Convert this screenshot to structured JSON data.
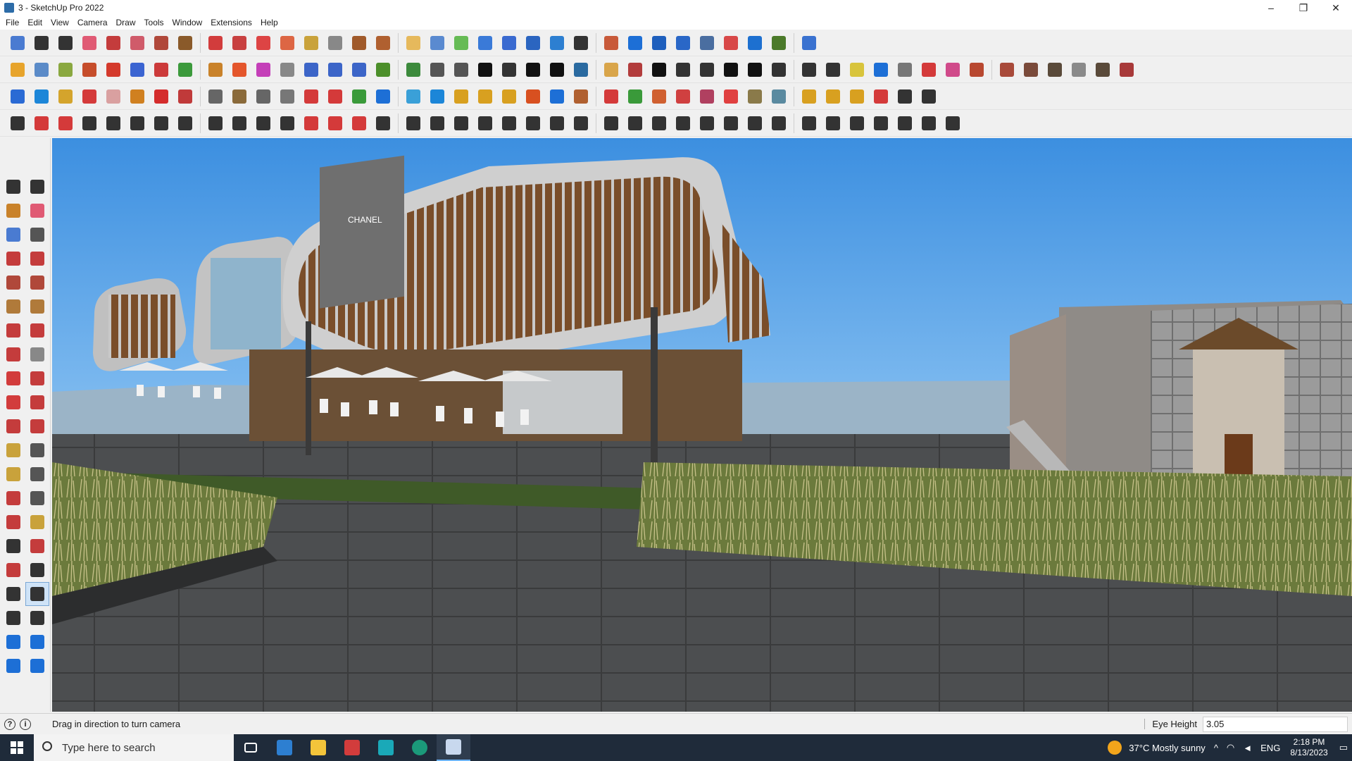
{
  "window": {
    "title": "3 - SketchUp Pro 2022",
    "minimize": "–",
    "restore": "❐",
    "close": "✕"
  },
  "menu": [
    "File",
    "Edit",
    "View",
    "Camera",
    "Draw",
    "Tools",
    "Window",
    "Extensions",
    "Help"
  ],
  "toolbars": {
    "row1": [
      "#4a7bd1",
      "#333",
      "#333",
      "#e05a74",
      "#c43c3c",
      "#d05b6a",
      "#b0483a",
      "#8a5a2a",
      "#d23c3c",
      "#c84040",
      "#d44",
      "#d64",
      "#c9a23b",
      "#888",
      "#a05a2a",
      "#b06030",
      "#e6b95c",
      "#5a8ad0",
      "#6b5",
      "#3a7ad8",
      "#3a6ad0",
      "#2b65c0",
      "#2d7fd1",
      "#333",
      "#c85a3a",
      "#1d6fd6",
      "#1e5fbd",
      "#2a67c7",
      "#4a6ea0",
      "#d84848",
      "#1d70d0",
      "#4b7a2a",
      "#3a72d0"
    ],
    "row2": [
      "#e7a42c",
      "#5b8bc8",
      "#8aa840",
      "#c64d2b",
      "#d43a2c",
      "#3b64d1",
      "#cc3a3a",
      "#3c9a3c",
      "#c9822a",
      "#e4562c",
      "#c43fb8",
      "#888",
      "#3c65c8",
      "#3c65c8",
      "#3c65c8",
      "#4c8f2a",
      "#3c8a3c",
      "#555",
      "#555",
      "#111",
      "#333",
      "#111",
      "#111",
      "#2a6aa0",
      "#d9a54a",
      "#b23c3c",
      "#111",
      "#333",
      "#333",
      "#111",
      "#111",
      "#333",
      "#333",
      "#333",
      "#d8c43c",
      "#1d6fd6",
      "#777",
      "#d43a3a",
      "#d04a8a",
      "#b84830",
      "#a84a3a",
      "#7a4a3a",
      "#5a4a3a",
      "#8a8a8a",
      "#5a4a3a",
      "#a83a3a"
    ],
    "row3": [
      "#2a6ad4",
      "#1c86d8",
      "#d4a42c",
      "#d43a3a",
      "#d9a0a0",
      "#d08020",
      "#d42c2c",
      "#c03a3a",
      "#666",
      "#8a6a3a",
      "#666",
      "#777",
      "#d43a3a",
      "#d43a3a",
      "#3a9a3a",
      "#1d6fd6",
      "#3aa0d8",
      "#1c86d8",
      "#d8a020",
      "#d8a020",
      "#d8a020",
      "#d85020",
      "#1d6fd6",
      "#b06030",
      "#d43a3a",
      "#3a9a3a",
      "#d06030",
      "#d04040",
      "#b04060",
      "#e04040",
      "#8a7a4a",
      "#5a8aa0",
      "#d8a020",
      "#d8a020",
      "#d8a020",
      "#d43a3a",
      "#333",
      "#333"
    ],
    "row4": [
      "#333",
      "#d43a3a",
      "#d43a3a",
      "#333",
      "#333",
      "#333",
      "#333",
      "#333",
      "#333",
      "#333",
      "#333",
      "#333",
      "#d43a3a",
      "#d43a3a",
      "#d43a3a",
      "#333",
      "#333",
      "#333",
      "#333",
      "#333",
      "#333",
      "#333",
      "#333",
      "#333",
      "#333",
      "#333",
      "#333",
      "#333",
      "#333",
      "#333",
      "#333",
      "#333",
      "#333",
      "#333",
      "#333",
      "#333",
      "#333",
      "#333",
      "#333"
    ]
  },
  "left_tools": [
    {
      "name": "select-tool",
      "c": "#333"
    },
    {
      "name": "orbit-tool",
      "c": "#333"
    },
    {
      "name": "paint-bucket-tool",
      "c": "#c9822a"
    },
    {
      "name": "eraser-tool",
      "c": "#e05a74"
    },
    {
      "name": "component-tool",
      "c": "#4a7bd1"
    },
    {
      "name": "tape-tool",
      "c": "#555"
    },
    {
      "name": "line-tool",
      "c": "#c43c3c"
    },
    {
      "name": "freehand-tool",
      "c": "#c43c3c"
    },
    {
      "name": "rectangle-tool",
      "c": "#b0483a"
    },
    {
      "name": "rotated-rectangle-tool",
      "c": "#b0483a"
    },
    {
      "name": "circle-tool",
      "c": "#b07a3a"
    },
    {
      "name": "polygon-tool",
      "c": "#b07a3a"
    },
    {
      "name": "arc-tool",
      "c": "#c43c3c"
    },
    {
      "name": "two-point-arc-tool",
      "c": "#c43c3c"
    },
    {
      "name": "pie-tool",
      "c": "#c43c3c"
    },
    {
      "name": "push-pull-small-tool",
      "c": "#888"
    },
    {
      "name": "move-tool",
      "c": "#d23c3c"
    },
    {
      "name": "push-pull-tool",
      "c": "#c43c3c"
    },
    {
      "name": "rotate-tool",
      "c": "#d23c3c"
    },
    {
      "name": "follow-me-tool",
      "c": "#c43c3c"
    },
    {
      "name": "scale-tool",
      "c": "#c43c3c"
    },
    {
      "name": "offset-tool",
      "c": "#c43c3c"
    },
    {
      "name": "tape-measure-tool",
      "c": "#c9a23b"
    },
    {
      "name": "dimension-tool",
      "c": "#555"
    },
    {
      "name": "protractor-tool",
      "c": "#c9a23b"
    },
    {
      "name": "text-tool",
      "c": "#555"
    },
    {
      "name": "axes-tool",
      "c": "#c43c3c"
    },
    {
      "name": "3d-text-tool",
      "c": "#555"
    },
    {
      "name": "orbit-camera-tool",
      "c": "#c43c3c"
    },
    {
      "name": "pan-tool",
      "c": "#c9a23b"
    },
    {
      "name": "zoom-tool",
      "c": "#333"
    },
    {
      "name": "zoom-window-tool",
      "c": "#c43c3c"
    },
    {
      "name": "zoom-extents-tool",
      "c": "#c43c3c"
    },
    {
      "name": "previous-view-tool",
      "c": "#333"
    },
    {
      "name": "position-camera-tool",
      "c": "#333"
    },
    {
      "name": "look-around-tool",
      "c": "#333"
    },
    {
      "name": "walk-tool",
      "c": "#333"
    },
    {
      "name": "section-plane-tool",
      "c": "#333"
    },
    {
      "name": "section-display-tool",
      "c": "#1d6fd6"
    },
    {
      "name": "section-fill-tool",
      "c": "#1d6fd6"
    },
    {
      "name": "layer-tool",
      "c": "#1d6fd6"
    },
    {
      "name": "outliner-tool",
      "c": "#1d6fd6"
    }
  ],
  "status": {
    "message": "Drag in direction to turn camera",
    "measure_label": "Eye Height",
    "measure_value": "3.05"
  },
  "taskbar": {
    "search_placeholder": "Type here to search",
    "weather": "37°C  Mostly sunny",
    "lang": "ENG",
    "time": "2:18 PM",
    "date": "8/13/2023"
  },
  "scene": {
    "sky_top": "#3c8fe0",
    "sky_bottom": "#bcdcf6",
    "ground": "#4d4f50",
    "grass": "#6e7e3a",
    "wood": "#7a4e2a",
    "facade": "#9c9c9c",
    "sign": "CHANEL"
  }
}
